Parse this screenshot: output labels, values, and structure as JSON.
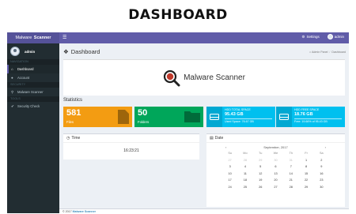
{
  "heading": "DASHBOARD",
  "app": {
    "brand_prefix": "Malware",
    "brand_strong": "Scanner",
    "accent": "#605ca8"
  },
  "topbar": {
    "menu_icon": "hamburger-icon",
    "settings_label": "Settings",
    "user_label": "admin"
  },
  "sidebar": {
    "user_name": "admin",
    "sections": [
      {
        "header": "NAVIGATION",
        "items": [
          {
            "label": "Dashboard",
            "icon": "home-icon",
            "active": true
          },
          {
            "label": "Account",
            "icon": "user-icon",
            "active": false
          }
        ]
      },
      {
        "header": "SECURITY",
        "items": [
          {
            "label": "Malware Scanner",
            "icon": "search-icon",
            "active": false
          }
        ]
      },
      {
        "header": "TOOLS",
        "items": [
          {
            "label": "Security Check",
            "icon": "check-icon",
            "active": false
          }
        ]
      }
    ]
  },
  "page": {
    "title": "Dashboard",
    "breadcrumb": [
      "Admin Panel",
      "Dashboard"
    ]
  },
  "hero": {
    "title": "Malware Scanner"
  },
  "stats": {
    "label": "Statistics",
    "files": {
      "value": "581",
      "label": "Files",
      "color": "#f39c12"
    },
    "folders": {
      "value": "50",
      "label": "Folders",
      "color": "#00a65a"
    },
    "total_space": {
      "label": "HDD TOTAL SPACE",
      "value": "95.43 GB",
      "sub": "Used Space: 76.67 GB",
      "color": "#00c0ef"
    },
    "free_space": {
      "label": "HDD FREE SPACE",
      "value": "18.76 GB",
      "sub": "Free: 19.66% of 95.43 GB",
      "color": "#00c0ef"
    }
  },
  "time_panel": {
    "title": "Time",
    "value": "16:23:21"
  },
  "date_panel": {
    "title": "Date",
    "month": "September, 2017",
    "weekdays": [
      "Su",
      "Mo",
      "Tu",
      "We",
      "Th",
      "Fr",
      "Sa"
    ],
    "weeks": [
      [
        "27",
        "28",
        "29",
        "30",
        "31",
        "1",
        "2"
      ],
      [
        "3",
        "4",
        "5",
        "6",
        "7",
        "8",
        "9"
      ],
      [
        "10",
        "11",
        "12",
        "13",
        "14",
        "15",
        "16"
      ],
      [
        "17",
        "18",
        "19",
        "20",
        "21",
        "22",
        "23"
      ],
      [
        "24",
        "25",
        "26",
        "27",
        "28",
        "29",
        "30"
      ]
    ]
  },
  "footer": {
    "text": "© 2017",
    "link": "Malware Scanner"
  }
}
